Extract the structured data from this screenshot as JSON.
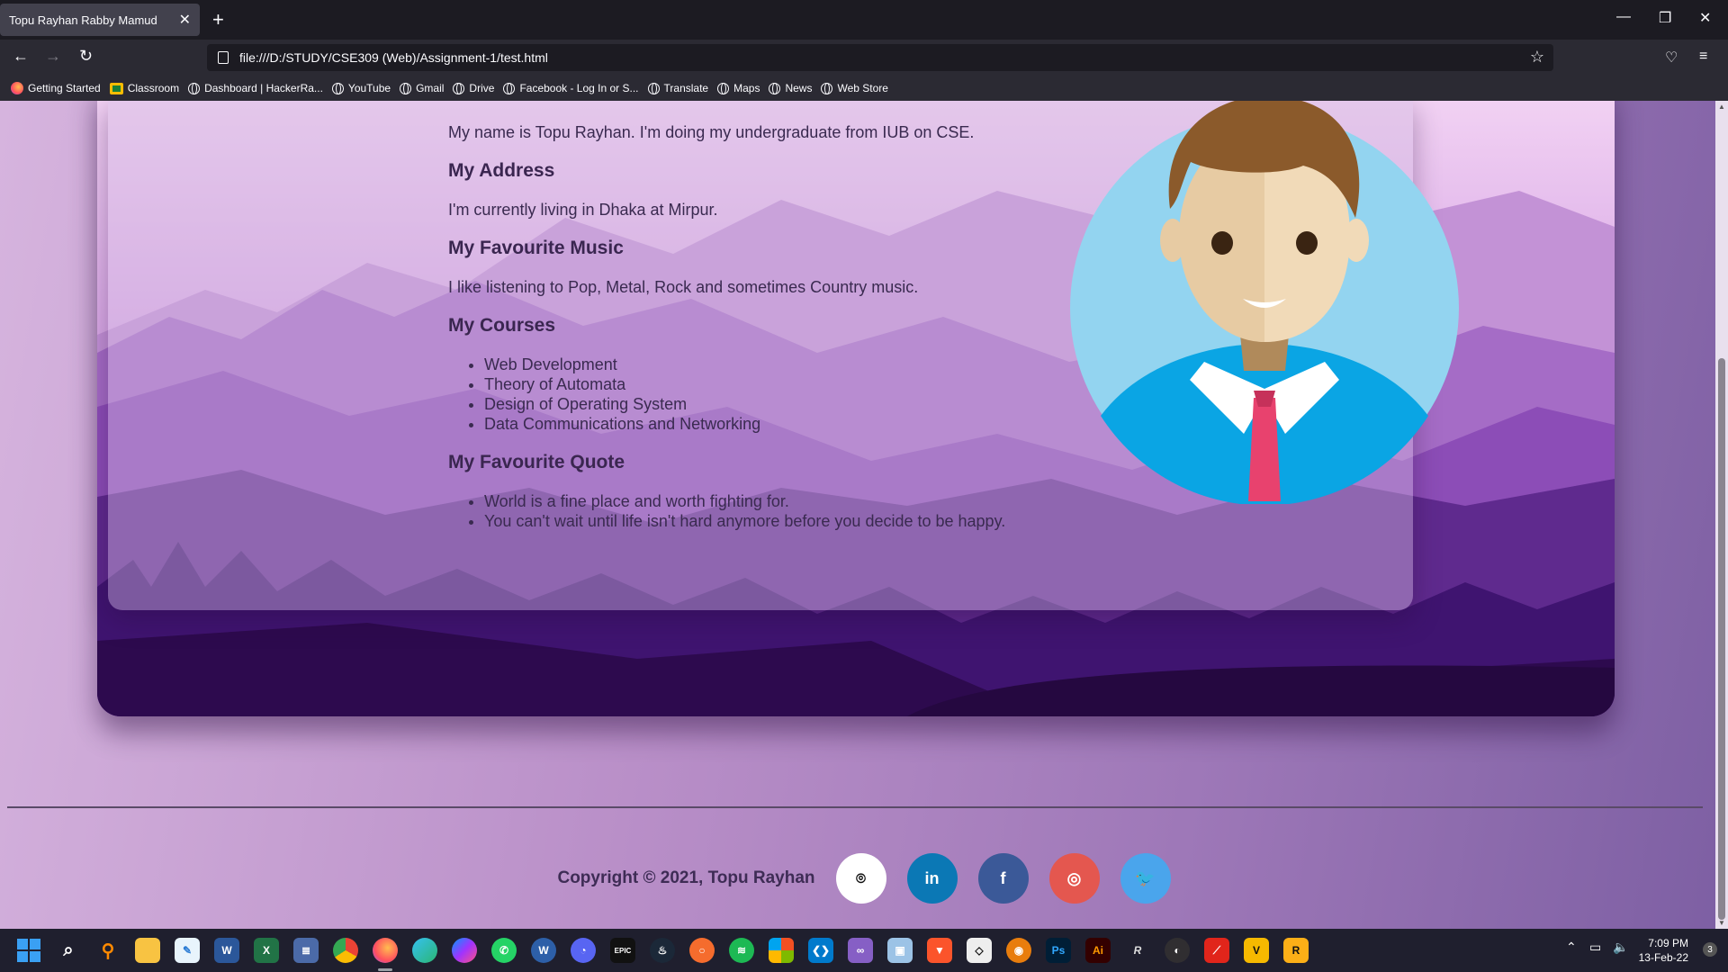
{
  "browser": {
    "tab_title": "Topu Rayhan Rabby Mamud",
    "url": "file:///D:/STUDY/CSE309 (Web)/Assignment-1/test.html",
    "bookmarks": [
      "Getting Started",
      "Classroom",
      "Dashboard | HackerRa...",
      "YouTube",
      "Gmail",
      "Drive",
      "Facebook - Log In or S...",
      "Translate",
      "Maps",
      "News",
      "Web Store"
    ]
  },
  "about": {
    "intro": "My name is Topu Rayhan. I'm doing my undergraduate from IUB on CSE.",
    "address_heading": "My Address",
    "address": "I'm currently living in Dhaka at Mirpur.",
    "music_heading": "My Favourite Music",
    "music": "I like listening to Pop, Metal, Rock and sometimes Country music.",
    "courses_heading": "My Courses",
    "courses": [
      "Web Development",
      "Theory of Automata",
      "Design of Operating System",
      "Data Communications and Networking"
    ],
    "quote_heading": "My Favourite Quote",
    "quotes": [
      "World is a fine place and worth fighting for.",
      "You can't wait until life isn't hard anymore before you decide to be happy."
    ]
  },
  "footer": {
    "copyright": "Copyright © 2021, Topu Rayhan",
    "social": [
      {
        "name": "github",
        "glyph": "⌾",
        "color": "#ffffff"
      },
      {
        "name": "linkedin",
        "glyph": "in",
        "color": "#0b78b5"
      },
      {
        "name": "facebook",
        "glyph": "f",
        "color": "#3b5998"
      },
      {
        "name": "instagram",
        "glyph": "◎",
        "color": "#e4574f"
      },
      {
        "name": "twitter",
        "glyph": "🐦",
        "color": "#4aa5ec"
      }
    ]
  },
  "taskbar": {
    "time": "7:09 PM",
    "date": "13-Feb-22",
    "notifications": "3",
    "apps": [
      "start",
      "search",
      "everything",
      "file-explorer",
      "notepad",
      "word",
      "excel",
      "files",
      "chrome",
      "firefox",
      "edge",
      "messenger",
      "whatsapp",
      "w-app",
      "discord",
      "epic-games",
      "steam",
      "origin",
      "spotify",
      "office",
      "vscode",
      "visual-studio",
      "virtualbox",
      "brave",
      "unity",
      "blender",
      "photoshop",
      "illustrator",
      "rockstar",
      "obs",
      "forza",
      "v-app",
      "rockstar-launcher"
    ]
  },
  "colors": {
    "page_text": "#3a2a50",
    "card_bg": "rgba(210,185,225,0.42)",
    "hero_dark": "#2d0a4e"
  }
}
